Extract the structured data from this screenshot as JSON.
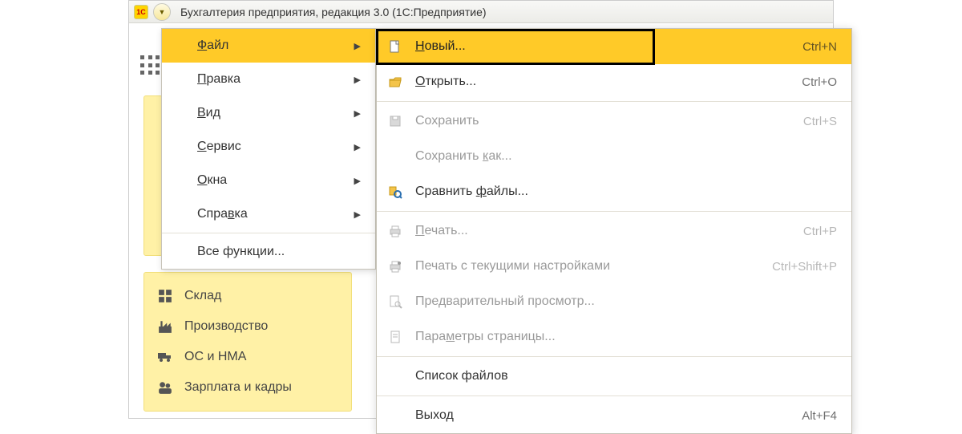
{
  "titlebar": {
    "logo_text": "1C",
    "title": "Бухгалтерия предприятия, редакция 3.0  (1С:Предприятие)"
  },
  "sidebar": {
    "items": [
      {
        "label": "Склад"
      },
      {
        "label": "Производство"
      },
      {
        "label": "ОС и НМА"
      },
      {
        "label": "Зарплата и кадры"
      }
    ]
  },
  "main_menu": {
    "items": [
      {
        "label": "Файл",
        "u_index": 0,
        "has_sub": true,
        "active": true
      },
      {
        "label": "Правка",
        "u_index": 0,
        "has_sub": true
      },
      {
        "label": "Вид",
        "u_index": 0,
        "has_sub": true
      },
      {
        "label": "Сервис",
        "u_index": 0,
        "has_sub": true
      },
      {
        "label": "Окна",
        "u_index": 0,
        "has_sub": true
      },
      {
        "label": "Справка",
        "u_index": 4,
        "has_sub": true
      }
    ],
    "sep_after": 5,
    "tail": [
      {
        "label": "Все функции..."
      }
    ]
  },
  "file_menu": {
    "items": [
      {
        "icon": "file-new",
        "u_index": 0,
        "label": "Новый...",
        "shortcut": "Ctrl+N",
        "active": true,
        "disabled": false
      },
      {
        "icon": "folder-open",
        "u_index": 0,
        "label": "Открыть...",
        "shortcut": "Ctrl+O",
        "disabled": false
      },
      {
        "sep": true
      },
      {
        "icon": "save",
        "u_index": -1,
        "label": "Сохранить",
        "shortcut": "Ctrl+S",
        "disabled": true
      },
      {
        "icon": "",
        "u_index": 10,
        "label": "Сохранить как...",
        "shortcut": "",
        "disabled": true
      },
      {
        "icon": "compare",
        "u_index": 9,
        "label": "Сравнить файлы...",
        "shortcut": "",
        "disabled": false
      },
      {
        "sep": true
      },
      {
        "icon": "print",
        "u_index": 0,
        "label": "Печать...",
        "shortcut": "Ctrl+P",
        "disabled": true
      },
      {
        "icon": "print-cfg",
        "u_index": -1,
        "label": "Печать с текущими настройками",
        "shortcut": "Ctrl+Shift+P",
        "disabled": true
      },
      {
        "icon": "preview",
        "u_index": -1,
        "label": "Предварительный просмотр...",
        "shortcut": "",
        "disabled": true
      },
      {
        "icon": "page-setup",
        "u_index": 4,
        "label": "Параметры страницы...",
        "shortcut": "",
        "disabled": true
      },
      {
        "sep": true
      },
      {
        "icon": "",
        "u_index": -1,
        "label": "Список файлов",
        "shortcut": "",
        "disabled": false
      },
      {
        "sep": true
      },
      {
        "icon": "",
        "u_index": -1,
        "label": "Выход",
        "shortcut": "Alt+F4",
        "disabled": false
      }
    ]
  }
}
